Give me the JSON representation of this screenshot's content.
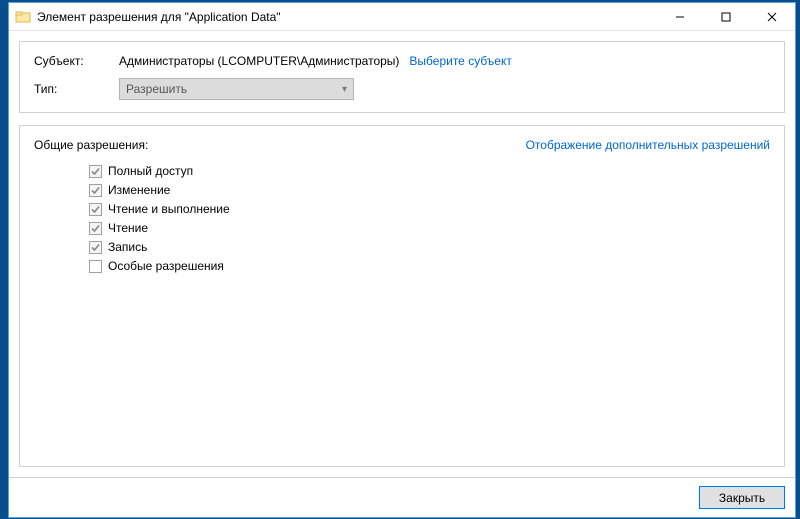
{
  "window": {
    "title": "Элемент разрешения для \"Application Data\""
  },
  "subject": {
    "label": "Субъект:",
    "value": "Администраторы (LCOMPUTER\\Администраторы)",
    "select_link": "Выберите субъект"
  },
  "type": {
    "label": "Тип:",
    "value": "Разрешить"
  },
  "permissions": {
    "heading": "Общие разрешения:",
    "advanced_link": "Отображение дополнительных разрешений",
    "items": [
      {
        "label": "Полный доступ",
        "checked": true
      },
      {
        "label": "Изменение",
        "checked": true
      },
      {
        "label": "Чтение и выполнение",
        "checked": true
      },
      {
        "label": "Чтение",
        "checked": true
      },
      {
        "label": "Запись",
        "checked": true
      },
      {
        "label": "Особые разрешения",
        "checked": false
      }
    ]
  },
  "footer": {
    "close_label": "Закрыть"
  }
}
